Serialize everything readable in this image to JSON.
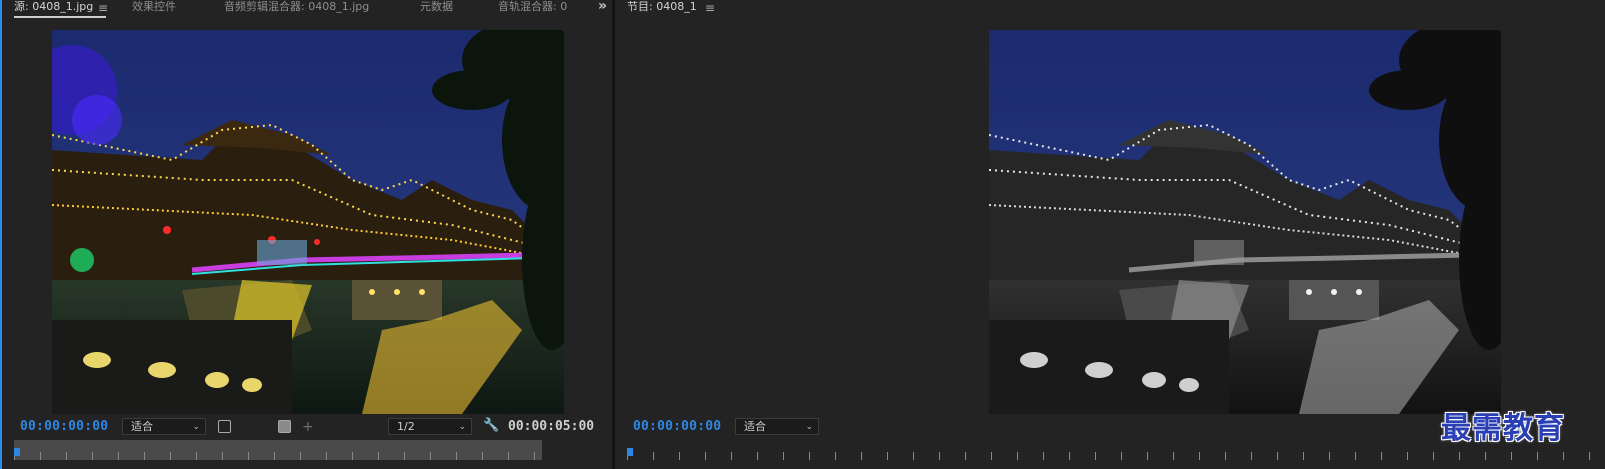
{
  "source_panel": {
    "tabs": [
      {
        "label": "源: 0408_1.jpg",
        "active": true
      },
      {
        "label": "效果控件",
        "active": false
      },
      {
        "label": "音频剪辑混合器: 0408_1.jpg",
        "active": false
      },
      {
        "label": "元数据",
        "active": false
      },
      {
        "label": "音轨混合器: 0",
        "active": false
      }
    ],
    "timecode_current": "00:00:00:00",
    "fit_select": "适合",
    "resolution_select": "1/2",
    "timecode_duration": "00:00:05:00"
  },
  "program_panel": {
    "tab_label": "节目: 0408_1",
    "timecode_current": "00:00:00:00",
    "fit_select": "适合"
  },
  "icons": {
    "menu": "≡",
    "overflow": "»",
    "caret": "⌄",
    "wrench": "🔧",
    "add_marker": "+"
  },
  "watermark": "最需教育",
  "colors": {
    "accent_blue": "#2f86e2",
    "panel_bg": "#232323"
  }
}
